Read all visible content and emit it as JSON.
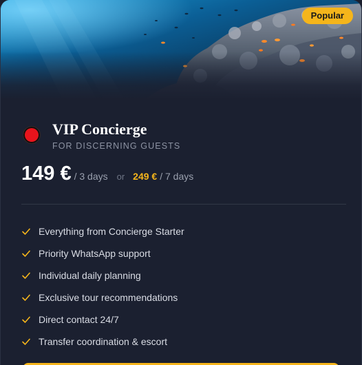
{
  "card": {
    "badge": "Popular",
    "plan_name": "VIP Concierge",
    "plan_subtitle": "FOR DISCERNING GUESTS",
    "price": {
      "main": "149 €",
      "main_period": "/ 3 days",
      "or": "or",
      "alt": "249 €",
      "alt_period": "/ 7 days"
    },
    "features": [
      "Everything from Concierge Starter",
      "Priority WhatsApp support",
      "Individual daily planning",
      "Exclusive tour recommendations",
      "Direct contact 24/7",
      "Transfer coordination & escort"
    ]
  },
  "colors": {
    "card_background": "#1b2030",
    "accent": "#f5b51b",
    "plan_dot": "#e8141c",
    "text_primary": "#ffffff",
    "text_muted": "#8d93a3"
  },
  "icons": {
    "plan": "red-circle-icon",
    "feature": "check-icon"
  }
}
